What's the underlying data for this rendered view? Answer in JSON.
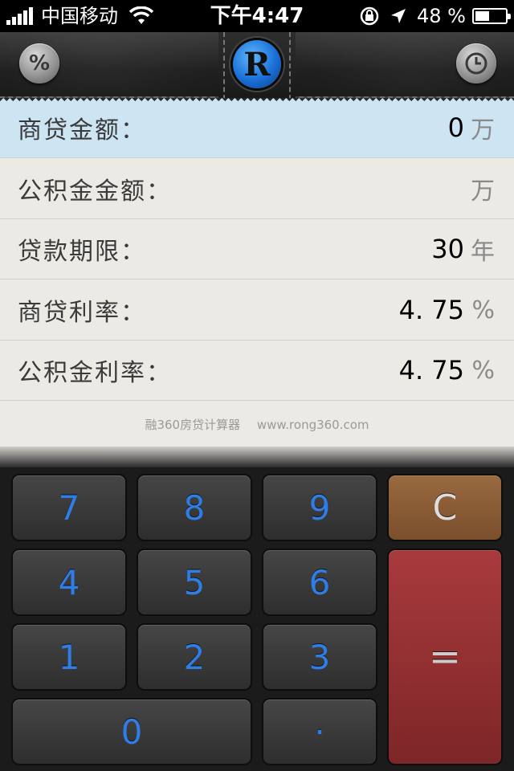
{
  "status_bar": {
    "carrier": "中国移动",
    "time": "下午4:47",
    "battery": "48 %",
    "battery_level": 0.48
  },
  "header": {
    "percent_icon_label": "%",
    "logo_letter": "R"
  },
  "form": {
    "rows": [
      {
        "label": "商贷金额：",
        "value": "0",
        "unit": "万"
      },
      {
        "label": "公积金金额：",
        "value": "",
        "unit": "万"
      },
      {
        "label": "贷款期限：",
        "value": "30",
        "unit": "年"
      },
      {
        "label": "商贷利率：",
        "value": "4. 75",
        "unit": "%"
      },
      {
        "label": "公积金利率：",
        "value": "4. 75",
        "unit": "%"
      }
    ],
    "footer_app": "融360房贷计算器",
    "footer_site": "www.rong360.com"
  },
  "keypad": {
    "keys": [
      "7",
      "8",
      "9",
      "C",
      "4",
      "5",
      "6",
      "1",
      "2",
      "3",
      "=",
      "0",
      "·"
    ]
  },
  "colors": {
    "active_row": "#cde4f3",
    "key_digit": "#2f7ee8",
    "key_clear": "#8a5c35",
    "key_equals": "#962f31"
  }
}
